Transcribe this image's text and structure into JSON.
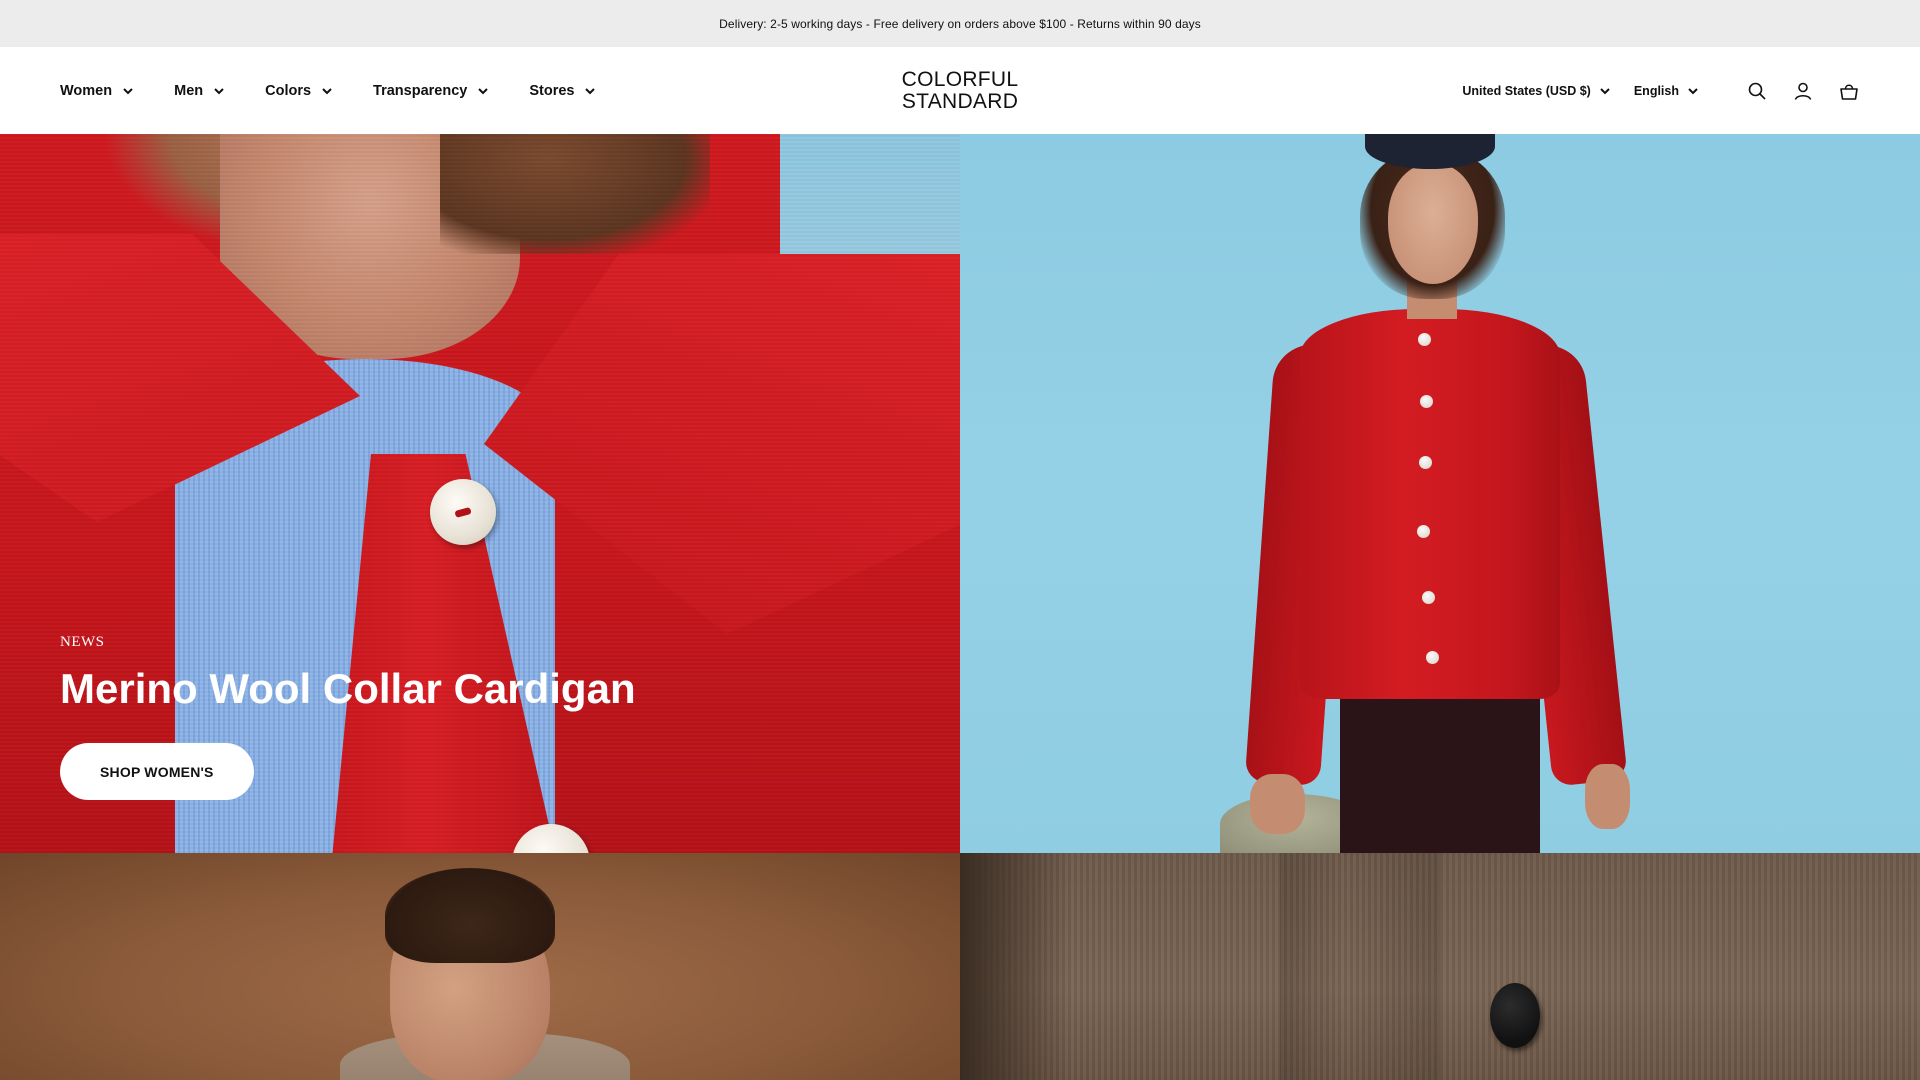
{
  "announcement": {
    "text": "Delivery: 2-5 working days - Free delivery on orders above $100 - Returns within 90 days"
  },
  "header": {
    "nav": [
      {
        "label": "Women"
      },
      {
        "label": "Men"
      },
      {
        "label": "Colors"
      },
      {
        "label": "Transparency"
      },
      {
        "label": "Stores"
      }
    ],
    "logo": {
      "line1": "COLORFUL",
      "line2": "STANDARD"
    },
    "country_selector": "United States (USD $)",
    "language_selector": "English",
    "icons": [
      "search-icon",
      "account-icon",
      "cart-icon"
    ]
  },
  "hero": {
    "kicker": "NEWS",
    "title": "Merino Wool Collar Cardigan",
    "cta": "SHOP WOMEN'S"
  },
  "colors": {
    "announcement_bg": "#ececec",
    "hero_red": "#cf1a20",
    "model_bg": "#8ccbe2",
    "cta_bg": "#ffffff"
  }
}
